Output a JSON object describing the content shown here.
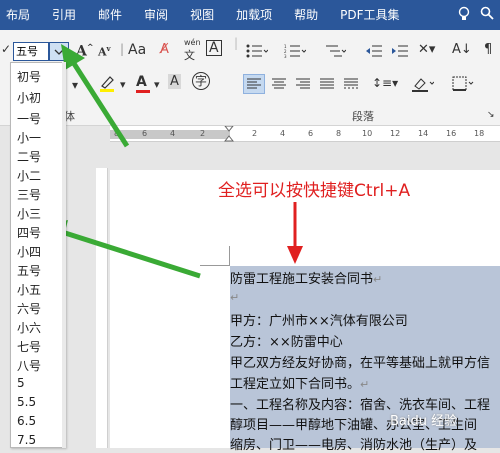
{
  "ribbon_tabs": [
    "布局",
    "引用",
    "邮件",
    "审阅",
    "视图",
    "加载项",
    "帮助",
    "PDF工具集"
  ],
  "tab_icons": [
    "lightbulb-icon",
    "search-icon"
  ],
  "font_size": {
    "current_value": "五号",
    "options": [
      "初号",
      "小初",
      "一号",
      "小一",
      "二号",
      "小二",
      "三号",
      "小三",
      "四号",
      "小四",
      "五号",
      "小五",
      "六号",
      "小六",
      "七号",
      "八号",
      "5",
      "5.5",
      "6.5",
      "7.5"
    ]
  },
  "ribbon": {
    "group_font_label_fragment": "体",
    "group_paragraph_label": "段落",
    "wen_glyph": "wén",
    "wen_char": "文",
    "zi_char": "字"
  },
  "ruler_numbers": [
    "8",
    "6",
    "4",
    "2",
    "2",
    "4",
    "6",
    "8",
    "10",
    "12",
    "14",
    "16",
    "18"
  ],
  "annotation": "全选可以按快捷键Ctrl+A",
  "document": {
    "lines": [
      "防雷工程施工安装合同书",
      "",
      "甲方：广州市××汽体有限公司",
      "乙方：××防雷中心",
      "甲乙双方经友好协商，在平等基础上就甲方信",
      "工程定立如下合同书。",
      "一、工程名称及内容：宿舍、洗衣车间、工程",
      "醇项目——甲醇地下油罐、办公室、卫生间",
      "缩房、门卫——电房、消防水池（生产）及"
    ]
  },
  "watermark": "Baidu 经验",
  "colors": {
    "accent": "#2b579a",
    "annotation": "#e02020",
    "arrow": "#3aaa35",
    "selection": "#b9c5d8"
  }
}
